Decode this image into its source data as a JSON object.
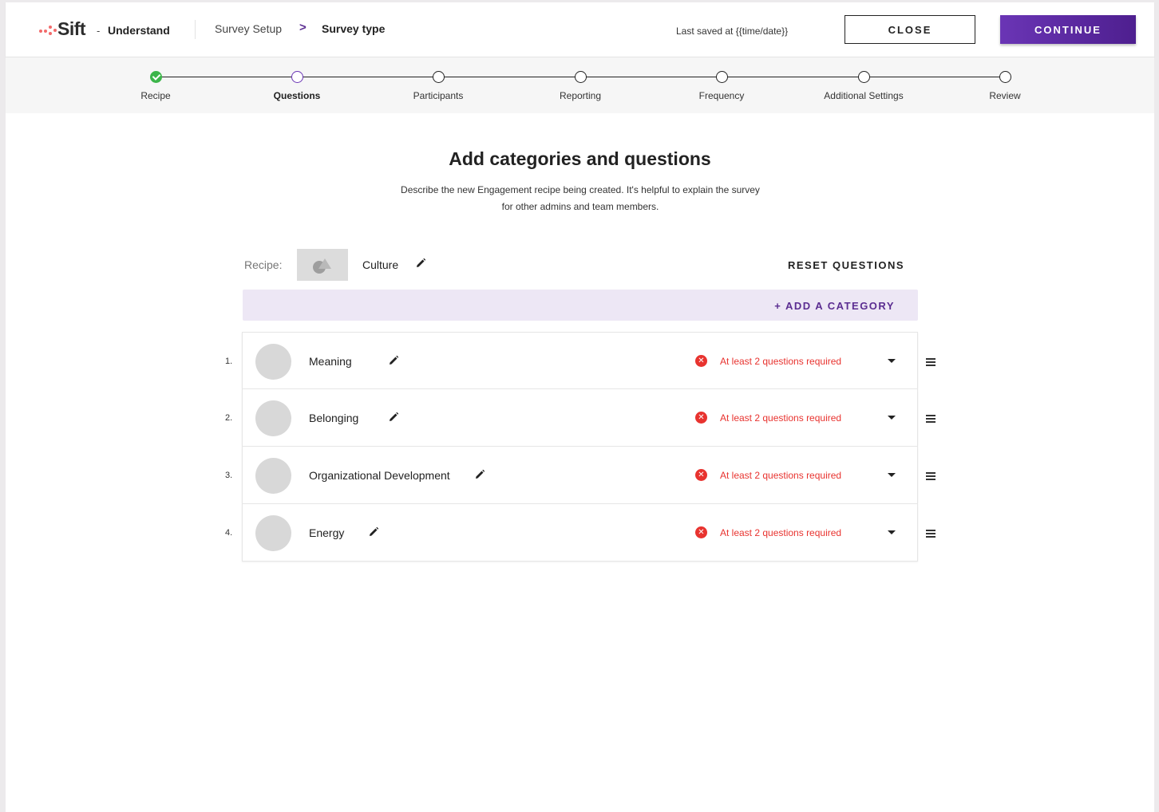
{
  "header": {
    "logo": "Sift",
    "separator": "-",
    "app_name": "Understand",
    "breadcrumb": [
      "Survey Setup",
      "Survey type"
    ],
    "breadcrumb_separator": ">",
    "last_saved": "Last saved at {{time/date}}",
    "close_label": "CLOSE",
    "continue_label": "CONTINUE"
  },
  "stepper": {
    "steps": [
      {
        "label": "Recipe",
        "state": "done"
      },
      {
        "label": "Questions",
        "state": "active"
      },
      {
        "label": "Participants",
        "state": "todo"
      },
      {
        "label": "Reporting",
        "state": "todo"
      },
      {
        "label": "Frequency",
        "state": "todo"
      },
      {
        "label": "Additional Settings",
        "state": "todo"
      },
      {
        "label": "Review",
        "state": "todo"
      }
    ]
  },
  "main": {
    "title": "Add categories and questions",
    "description": "Describe the new Engagement recipe being created. It's helpful to explain the survey for other admins and team members.",
    "recipe_label": "Recipe:",
    "recipe_name": "Culture",
    "reset_label": "RESET QUESTIONS",
    "add_category_label": "+ ADD A CATEGORY",
    "categories": [
      {
        "number": "1.",
        "name": "Meaning",
        "error": "At least 2 questions required"
      },
      {
        "number": "2.",
        "name": "Belonging",
        "error": "At least 2 questions required"
      },
      {
        "number": "3.",
        "name": "Organizational Development",
        "error": "At least 2 questions required"
      },
      {
        "number": "4.",
        "name": "Energy",
        "error": "At least 2 questions required"
      }
    ]
  },
  "colors": {
    "brand_purple": "#5b2d91",
    "error_red": "#e8332f",
    "success_green": "#3cb54a",
    "logo_coral": "#f26b6b"
  }
}
